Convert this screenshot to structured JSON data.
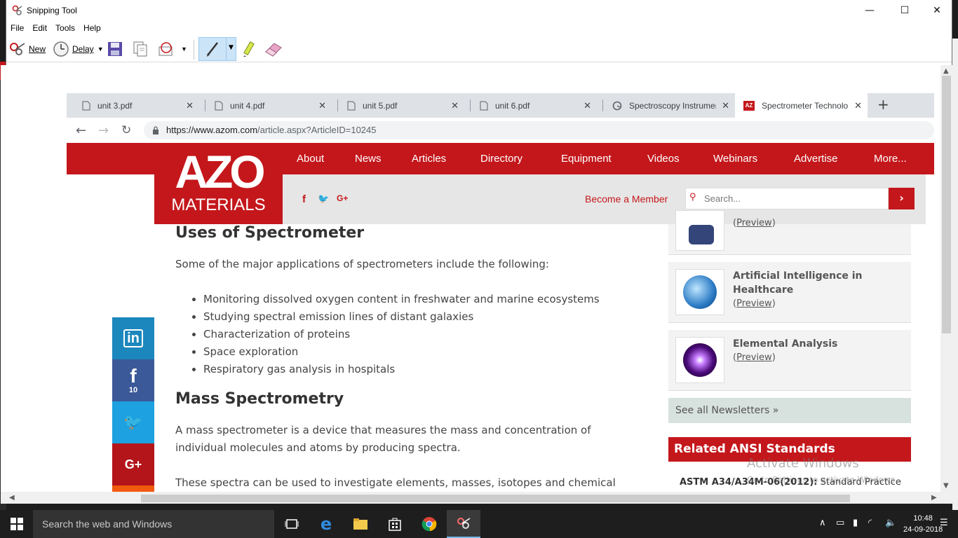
{
  "window": {
    "title": "Snipping Tool",
    "minimize": "—",
    "maximize": "☐",
    "close": "✕"
  },
  "menu": [
    "File",
    "Edit",
    "Tools",
    "Help"
  ],
  "toolbar": {
    "new_label": "New",
    "delay_label": "Delay"
  },
  "browser": {
    "tabs": [
      {
        "label": "unit 3.pdf",
        "icon": "document-icon"
      },
      {
        "label": "unit 4.pdf",
        "icon": "document-icon"
      },
      {
        "label": "unit 5.pdf",
        "icon": "document-icon"
      },
      {
        "label": "unit 6.pdf",
        "icon": "document-icon"
      },
      {
        "label": "Spectroscopy Instrumer",
        "icon": "loading-icon"
      },
      {
        "label": "Spectrometer Technolo",
        "icon": "azo-icon"
      }
    ],
    "new_tab": "+",
    "url_host": "https://www.azom.com",
    "url_path": "/article.aspx?ArticleID=10245"
  },
  "site": {
    "logo_big": "AZO",
    "logo_small": "MATERIALS",
    "nav": [
      "About",
      "News",
      "Articles",
      "Directory",
      "Equipment",
      "Videos",
      "Webinars",
      "Advertise",
      "More..."
    ],
    "social": [
      "f",
      "🐦",
      "G+"
    ],
    "member_link": "Become a Member",
    "search_placeholder": "Search...",
    "colors": {
      "brand": "#c4171b"
    }
  },
  "article": {
    "h_uses": "Uses of Spectrometer",
    "p_uses": "Some of the major applications of spectrometers include the following:",
    "bullets": [
      "Monitoring dissolved oxygen content in freshwater and marine ecosystems",
      "Studying spectral emission lines of distant galaxies",
      "Characterization of proteins",
      "Space exploration",
      "Respiratory gas analysis in hospitals"
    ],
    "h_mass": "Mass Spectrometry",
    "p_mass": "A mass spectrometer is a device that measures the mass and concentration of individual molecules and atoms by producing spectra.",
    "p_spectra": "These spectra can be used to investigate elements, masses, isotopes and chemical"
  },
  "share": {
    "linkedin": "in",
    "facebook": "f",
    "facebook_count": "10",
    "twitter": "🐦",
    "google": "G+"
  },
  "sidebar": {
    "cards": [
      {
        "title": "",
        "preview": "Preview"
      },
      {
        "title": "Artificial Intelligence in Healthcare",
        "preview": "Preview"
      },
      {
        "title": "Elemental Analysis",
        "preview": "Preview"
      }
    ],
    "see_all": "See all Newsletters »",
    "ansi_title": "Related ANSI Standards",
    "ansi_row_bold": "ASTM A34/A34M-06(2012):",
    "ansi_row_rest": " Standard Practice"
  },
  "watermark": {
    "line1": "Activate Windows",
    "line2": "Go to Settings to activate Windows."
  },
  "taskbar": {
    "search_text": "Search the web and Windows",
    "time": "10:48",
    "date": "24-09-2018"
  }
}
